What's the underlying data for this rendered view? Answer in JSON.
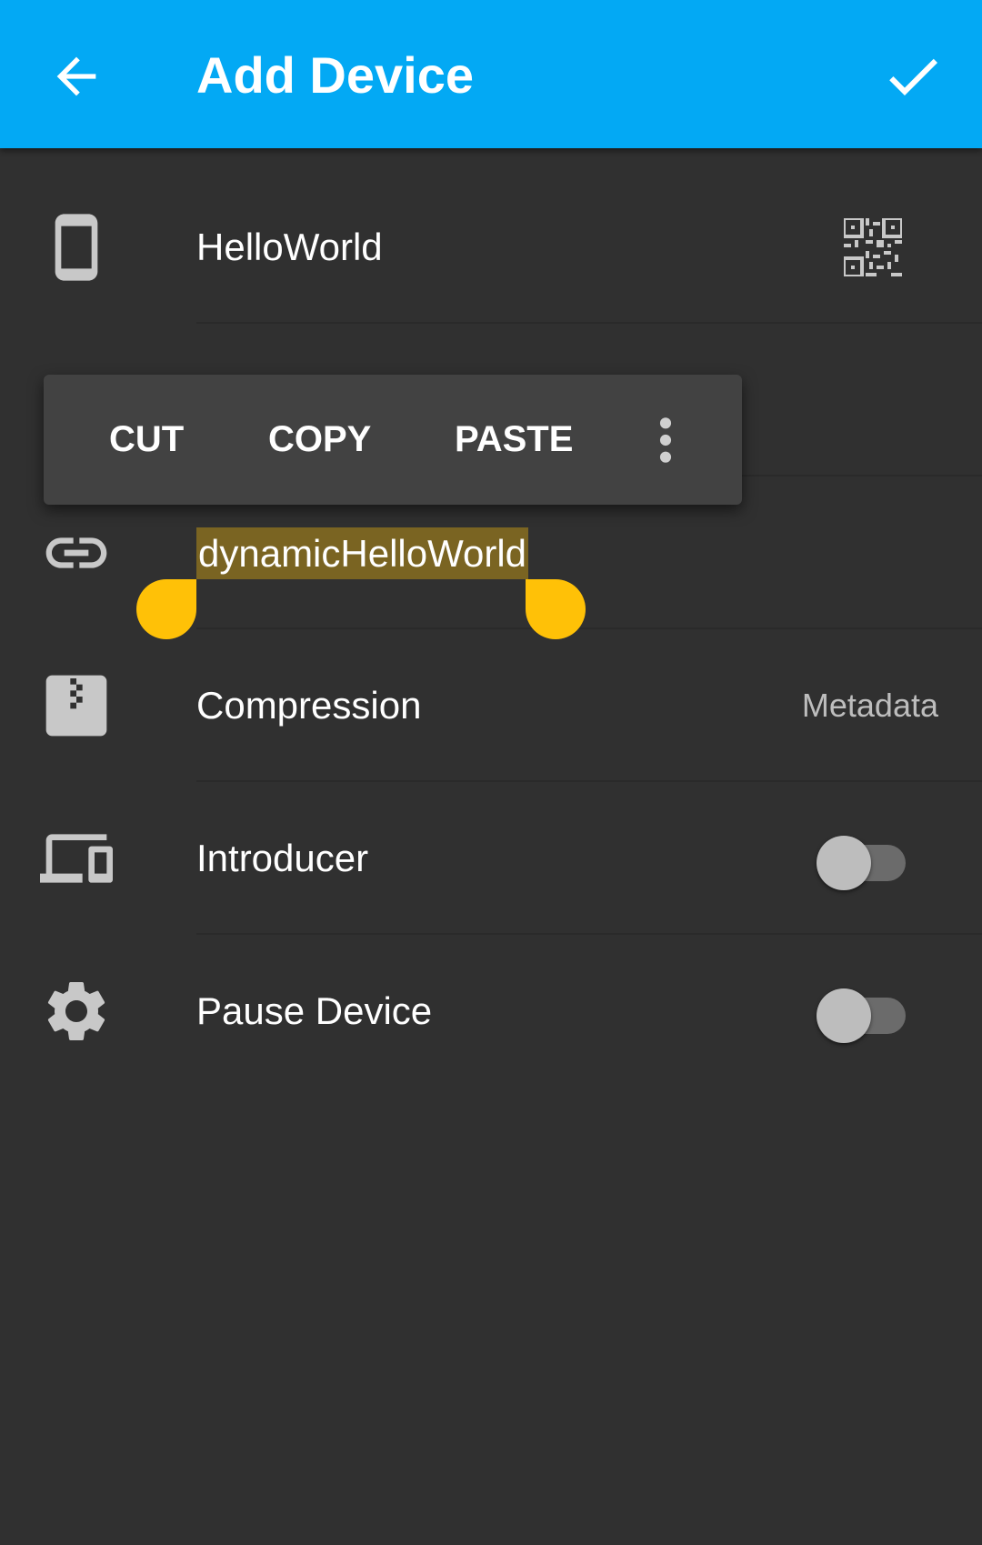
{
  "appbar": {
    "title": "Add Device",
    "back_icon": "arrow-back-icon",
    "confirm_icon": "check-icon",
    "color": "#03a9f4"
  },
  "rows": {
    "device_id": {
      "value": "HelloWorld",
      "icon": "phone-icon",
      "trailing_icon": "qr-code-icon"
    },
    "address": {
      "value": "dynamicHelloWorld",
      "icon": "link-icon"
    },
    "compression": {
      "label": "Compression",
      "value": "Metadata",
      "icon": "zip-icon"
    },
    "introducer": {
      "label": "Introducer",
      "icon": "devices-icon",
      "enabled": false
    },
    "pause_device": {
      "label": "Pause Device",
      "icon": "gear-icon",
      "enabled": false
    }
  },
  "context_menu": {
    "cut": "CUT",
    "copy": "COPY",
    "paste": "PASTE",
    "more_icon": "more-vert-icon"
  },
  "colors": {
    "background": "#303030",
    "selection": "#7a6422",
    "handle": "#ffc107"
  }
}
